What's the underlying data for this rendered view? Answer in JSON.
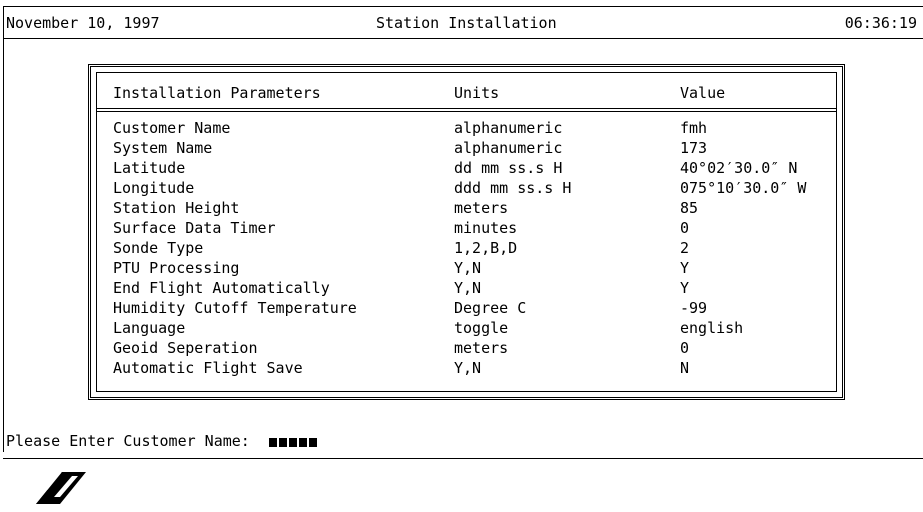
{
  "header": {
    "date": "November 10, 1997",
    "title": "Station Installation",
    "time": "06:36:19"
  },
  "table": {
    "columns": [
      "Installation Parameters",
      "Units",
      "Value"
    ],
    "rows": [
      {
        "param": "Customer Name",
        "units": "alphanumeric",
        "value": "fmh"
      },
      {
        "param": "System Name",
        "units": "alphanumeric",
        "value": "173"
      },
      {
        "param": "Latitude",
        "units": "dd mm ss.s H",
        "value": "40°02′30.0″ N"
      },
      {
        "param": "Longitude",
        "units": "ddd mm ss.s H",
        "value": "075°10′30.0″ W"
      },
      {
        "param": "Station Height",
        "units": "meters",
        "value": "85"
      },
      {
        "param": "Surface Data Timer",
        "units": "minutes",
        "value": "0"
      },
      {
        "param": "Sonde Type",
        "units": "1,2,B,D",
        "value": "2"
      },
      {
        "param": "PTU Processing",
        "units": "Y,N",
        "value": "Y"
      },
      {
        "param": "End Flight Automatically",
        "units": "Y,N",
        "value": "Y"
      },
      {
        "param": "Humidity Cutoff Temperature",
        "units": "Degree C",
        "value": "-99"
      },
      {
        "param": "Language",
        "units": "toggle",
        "value": "english"
      },
      {
        "param": "Geoid Seperation",
        "units": "meters",
        "value": "0"
      },
      {
        "param": "Automatic Flight Save",
        "units": "Y,N",
        "value": "N"
      }
    ]
  },
  "prompt": {
    "label": "Please Enter Customer Name:",
    "cursor_blocks": 5
  },
  "logo": {
    "icon": "diagonal-stripes-logo-icon"
  }
}
